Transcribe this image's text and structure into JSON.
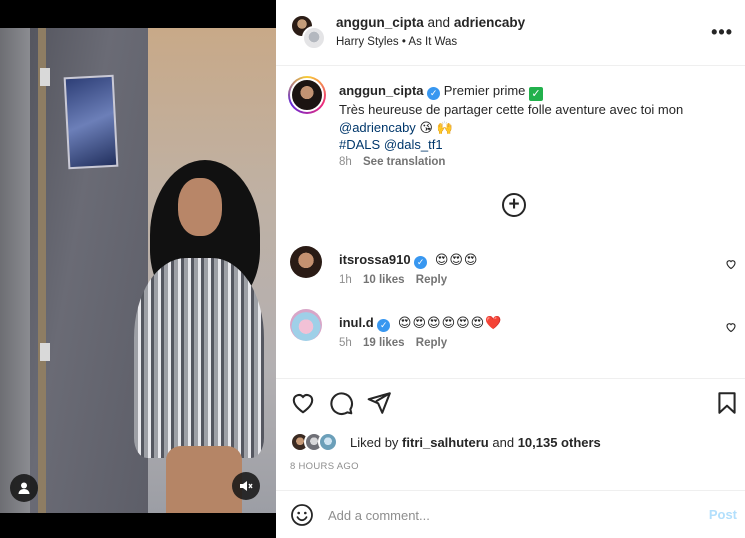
{
  "media": {
    "user_icon": "person-icon",
    "mute_icon": "muted-speaker-icon"
  },
  "header": {
    "user1": "anggun_cipta",
    "joiner": "and",
    "user2": "adriencaby",
    "audio": "Harry Styles • As It Was",
    "more_icon": "more-dots-icon"
  },
  "caption": {
    "username": "anggun_cipta",
    "text_start": "Premier prime",
    "line2": "Très heureuse de partager cette folle aventure avec toi mon",
    "mention": "@adriencaby",
    "line3_emojis": "😘 🙌",
    "hashtag": "#DALS",
    "mention2": "@dals_tf1",
    "time": "8h",
    "translate": "See translation"
  },
  "load_more_icon": "plus-circle-icon",
  "comments": [
    {
      "username": "itsrossa910",
      "emojis": "😍😍😍",
      "time": "1h",
      "likes": "10 likes",
      "reply": "Reply"
    },
    {
      "username": "inul.d",
      "emojis": "😍😍😍😍😍😍❤️",
      "time": "5h",
      "likes": "19 likes",
      "reply": "Reply"
    }
  ],
  "likes": {
    "prefix": "Liked by",
    "user": "fitri_salhuteru",
    "and": "and",
    "others": "10,135 others"
  },
  "timestamp": "8 HOURS AGO",
  "add_comment": {
    "placeholder": "Add a comment...",
    "post_label": "Post"
  },
  "colors": {
    "verified": "#3897f0",
    "post_disabled": "#b2dffc",
    "link": "#00376b"
  }
}
